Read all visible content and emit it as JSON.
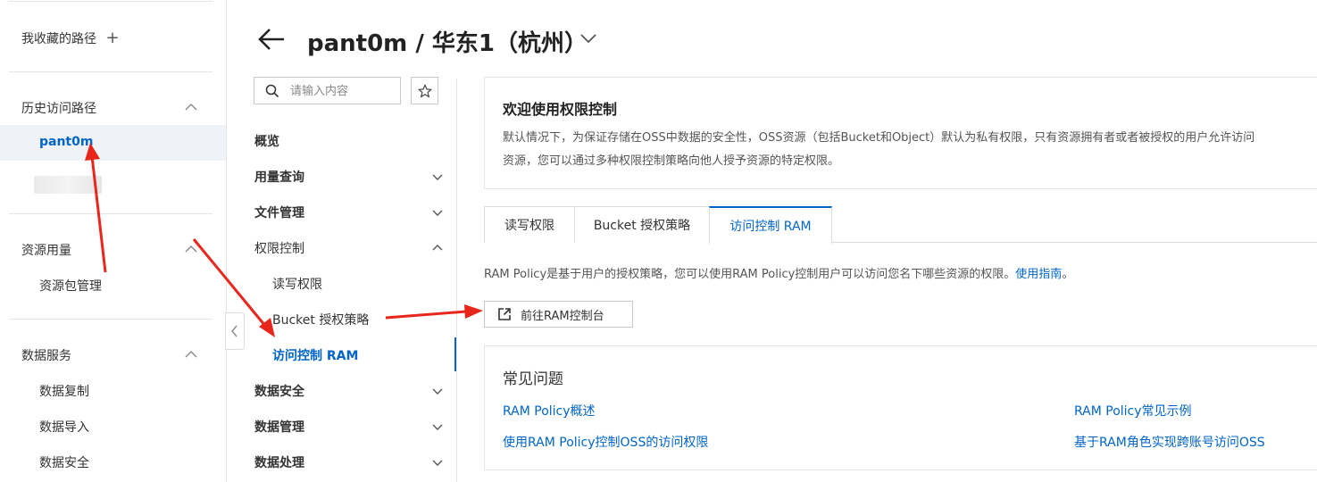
{
  "sidebar": {
    "favorites_label": "我收藏的路径",
    "favorites_add_glyph": "+",
    "history_label": "历史访问路径",
    "history_items": [
      "pant0m"
    ],
    "resource_label": "资源用量",
    "resource_items": [
      "资源包管理"
    ],
    "data_service_label": "数据服务",
    "data_service_items": [
      "数据复制",
      "数据导入",
      "数据安全"
    ]
  },
  "header": {
    "title": "pant0m / 华东1（杭州）"
  },
  "nav": {
    "search_placeholder": "请输入内容",
    "items": {
      "overview": "概览",
      "usage": "用量查询",
      "files": "文件管理",
      "permission": "权限控制",
      "permission_children": [
        "读写权限",
        "Bucket 授权策略",
        "访问控制 RAM"
      ],
      "data_security": "数据安全",
      "data_management": "数据管理",
      "data_processing": "数据处理"
    }
  },
  "welcome": {
    "title": "欢迎使用权限控制",
    "desc_line1": "默认情况下，为保证存储在OSS中数据的安全性，OSS资源（包括Bucket和Object）默认为私有权限，只有资源拥有者或者被授权的用户允许访问",
    "desc_line2": "资源，您可以通过多种权限控制策略向他人授予资源的特定权限。"
  },
  "tabs": [
    "读写权限",
    "Bucket 授权策略",
    "访问控制 RAM"
  ],
  "ram": {
    "description": "RAM Policy是基于用户的授权策略，您可以使用RAM Policy控制用户可以访问您名下哪些资源的权限。",
    "guide_link": "使用指南",
    "trailing": "。",
    "goto_button": "前往RAM控制台"
  },
  "faq": {
    "title": "常见问题",
    "links": [
      "RAM Policy概述",
      "RAM Policy常见示例",
      "使用RAM Policy控制OSS的访问权限",
      "基于RAM角色实现跨账号访问OSS"
    ]
  },
  "colors": {
    "accent": "#0064c8",
    "annotation_arrow": "#e8261c"
  }
}
